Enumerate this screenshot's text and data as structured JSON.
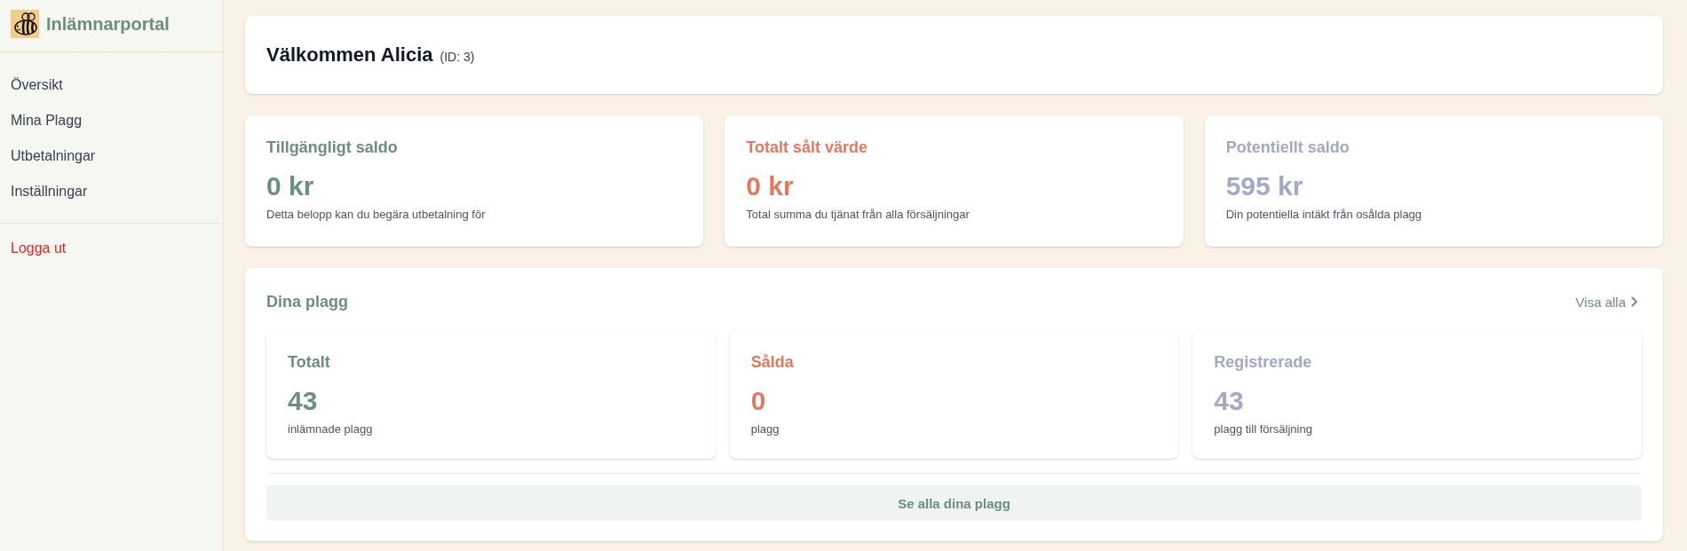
{
  "sidebar": {
    "brand": {
      "title": "Inlämnarportal"
    },
    "nav_items": [
      {
        "label": "Översikt",
        "selected": false
      },
      {
        "label": "Mina Plagg",
        "selected": false
      },
      {
        "label": "Utbetalningar",
        "selected": false
      },
      {
        "label": "Inställningar",
        "selected": false
      }
    ],
    "logout": {
      "label": "Logga ut"
    }
  },
  "welcome": {
    "title": "Välkommen Alicia",
    "id_label": "(ID: 3)"
  },
  "stat_cards": [
    {
      "title": "Tillgängligt saldo",
      "value": "0 kr",
      "description": "Detta belopp kan du begära utbetalning för",
      "color": "#6b8f7e"
    },
    {
      "title": "Totalt sålt värde",
      "value": "0 kr",
      "description": "Total summa du tjänat från alla försäljningar",
      "color": "#e07a5f"
    },
    {
      "title": "Potentiellt saldo",
      "value": "595 kr",
      "description": "Din potentiella intäkt från osålda plagg",
      "color": "#a3a8cc"
    }
  ],
  "garments": {
    "title": "Dina plagg",
    "view_all": "Visa alla",
    "cards": [
      {
        "title": "Totalt",
        "value": "43",
        "description": "inlämnade plagg",
        "color": "#6b8f7e"
      },
      {
        "title": "Sålda",
        "value": "0",
        "description": "plagg",
        "color": "#e07a5f"
      },
      {
        "title": "Registrerade",
        "value": "43",
        "description": "plagg till försäljning",
        "color": "#a3a8cc"
      }
    ],
    "button": "Se alla dina plagg"
  }
}
